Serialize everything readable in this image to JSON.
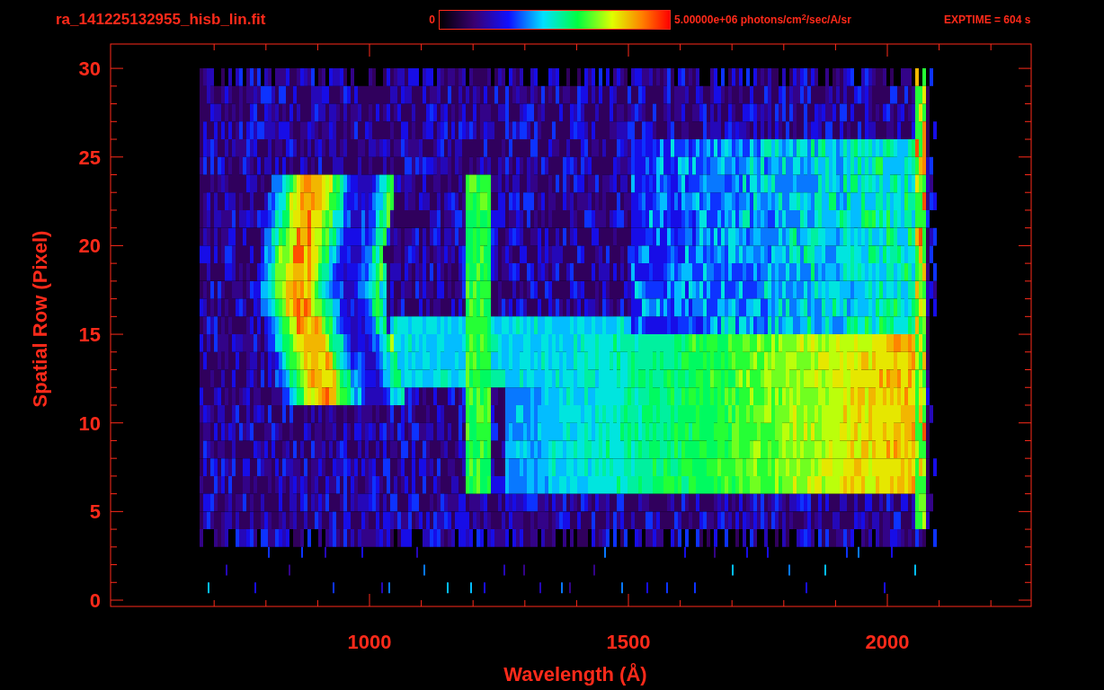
{
  "title": "ra_141225132955_hisb_lin.fit",
  "colorbar": {
    "min_label": "0",
    "max_label": "5.00000e+06 photons/cm$^{2}$/sec/A/sr"
  },
  "exptime": "EXPTIME = 604 s",
  "plot": {
    "xlabel": "Wavelength (Å)",
    "ylabel": "Spatial Row (Pixel)",
    "xticks": [
      "1000",
      "1500",
      "2000"
    ],
    "yticks": [
      "30",
      "25",
      "20",
      "15",
      "10",
      "5",
      "0"
    ]
  }
}
